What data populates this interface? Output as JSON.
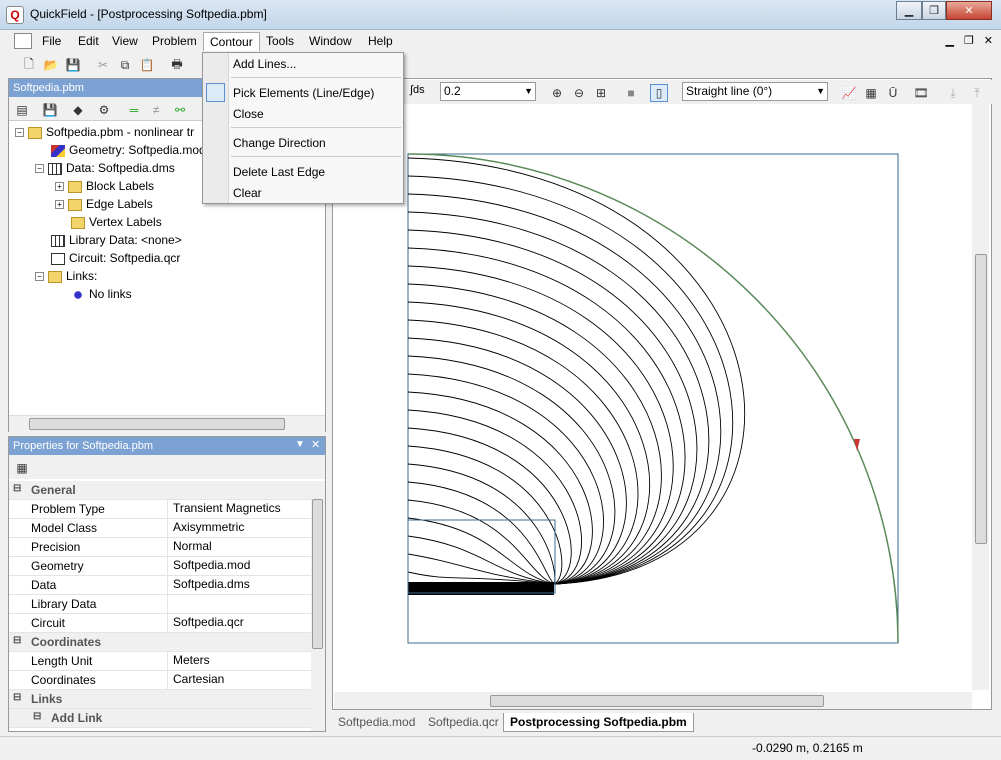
{
  "window": {
    "title": "QuickField - [Postprocessing Softpedia.pbm]"
  },
  "menu": [
    "File",
    "Edit",
    "View",
    "Problem",
    "Contour",
    "Tools",
    "Window",
    "Help"
  ],
  "contour_menu": {
    "items": [
      "Add Lines...",
      "Pick Elements (Line/Edge)",
      "Close",
      "Change Direction",
      "Delete Last Edge",
      "Clear"
    ]
  },
  "left_panel": {
    "title": "Softpedia.pbm",
    "tree": [
      {
        "label": "Softpedia.pbm - nonlinear tr"
      },
      {
        "label": "Geometry: Softpedia.mod"
      },
      {
        "label": "Data: Softpedia.dms"
      },
      {
        "label": "Block Labels"
      },
      {
        "label": "Edge Labels"
      },
      {
        "label": "Vertex Labels"
      },
      {
        "label": "Library Data: <none>"
      },
      {
        "label": "Circuit: Softpedia.qcr"
      },
      {
        "label": "Links:"
      },
      {
        "label": "No links"
      }
    ]
  },
  "properties": {
    "title": "Properties for Softpedia.pbm",
    "general": "General",
    "rows": [
      {
        "name": "Problem Type",
        "value": "Transient Magnetics"
      },
      {
        "name": "Model Class",
        "value": "Axisymmetric"
      },
      {
        "name": "Precision",
        "value": "Normal"
      },
      {
        "name": "Geometry",
        "value": "Softpedia.mod"
      },
      {
        "name": "Data",
        "value": "Softpedia.dms"
      },
      {
        "name": "Library Data",
        "value": ""
      },
      {
        "name": "Circuit",
        "value": "Softpedia.qcr"
      }
    ],
    "coordinates": "Coordinates",
    "coord_rows": [
      {
        "name": "Length Unit",
        "value": "Meters"
      },
      {
        "name": "Coordinates",
        "value": "Cartesian"
      }
    ],
    "links": "Links",
    "add_link": "Add Link"
  },
  "doc_toolbar": {
    "integral_symbol": "∫ds",
    "step_value": "0.2",
    "line_mode": "Straight line (0°)"
  },
  "tabs": [
    "Softpedia.mod",
    "Softpedia.qcr",
    "Postprocessing Softpedia.pbm"
  ],
  "status": {
    "coords": "-0.0290 m, 0.2165 m"
  }
}
